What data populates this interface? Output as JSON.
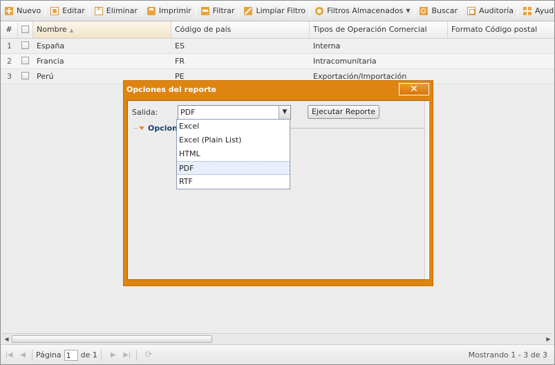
{
  "toolbar": {
    "buttons": [
      {
        "label": "Nuevo",
        "icon": "plus-icon"
      },
      {
        "label": "Editar",
        "icon": "edit-icon"
      },
      {
        "label": "Eliminar",
        "icon": "delete-icon"
      },
      {
        "label": "Imprimir",
        "icon": "print-icon"
      },
      {
        "label": "Filtrar",
        "icon": "filter-icon"
      },
      {
        "label": "Limpiar Filtro",
        "icon": "clear-filter-icon"
      },
      {
        "label": "Filtros Almacenados",
        "icon": "stored-filters-icon"
      },
      {
        "label": "Buscar",
        "icon": "search-icon"
      },
      {
        "label": "Auditoría",
        "icon": "audit-icon"
      },
      {
        "label": "Ayuda",
        "icon": "help-icon"
      }
    ]
  },
  "grid": {
    "columns": {
      "num": "#",
      "nombre": "Nombre",
      "codigo": "Código de país",
      "tipos": "Tipos de Operación Comercial",
      "formato": "Formato Código postal"
    },
    "rows": [
      {
        "num": "1",
        "nombre": "España",
        "codigo": "ES",
        "tipos": "Interna",
        "formato": ""
      },
      {
        "num": "2",
        "nombre": "Francia",
        "codigo": "FR",
        "tipos": "Intracomunitaria",
        "formato": ""
      },
      {
        "num": "3",
        "nombre": "Perú",
        "codigo": "PE",
        "tipos": "Exportación/Importación",
        "formato": ""
      }
    ]
  },
  "pager": {
    "page_label": "Página",
    "page_value": "1",
    "of_label": "de 1",
    "status": "Mostrando 1 - 3 de 3"
  },
  "modal": {
    "title": "Opciones del reporte",
    "close_label": "✕",
    "output_label": "Salida:",
    "output_selected": "PDF",
    "run_button": "Ejecutar Reporte",
    "options_legend": "Opciones",
    "output_options": [
      "Excel",
      "Excel (Plain List)",
      "HTML",
      "PDF",
      "RTF"
    ],
    "highlighted_option": "PDF"
  },
  "colors": {
    "accent": "#de8411",
    "modal_border": "#c46f06",
    "legend_text": "#1a3f6f"
  }
}
